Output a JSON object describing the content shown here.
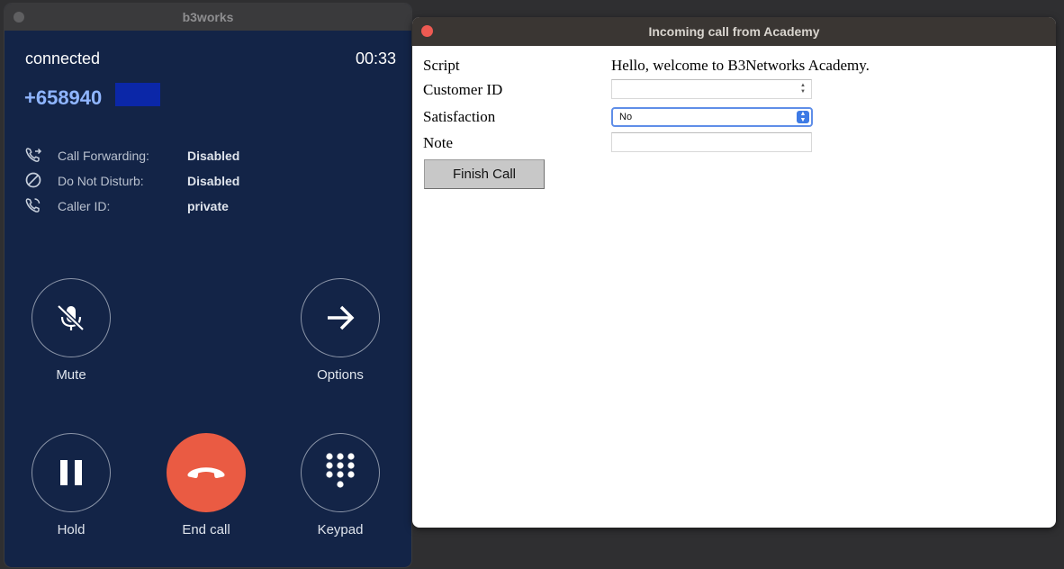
{
  "phone": {
    "title": "b3works",
    "status": "connected",
    "timer": "00:33",
    "number": "+658940",
    "info": [
      {
        "label": "Call Forwarding:",
        "value": "Disabled",
        "icon": "call-forward-icon"
      },
      {
        "label": "Do Not Disturb:",
        "value": "Disabled",
        "icon": "do-not-disturb-icon"
      },
      {
        "label": "Caller ID:",
        "value": "private",
        "icon": "caller-id-icon"
      }
    ],
    "buttons": {
      "mute": "Mute",
      "options": "Options",
      "hold": "Hold",
      "end": "End call",
      "keypad": "Keypad"
    },
    "colors": {
      "background": "#132447",
      "end_call": "#ea5b43",
      "number": "#8fb5ff"
    }
  },
  "dialog": {
    "title": "Incoming call from Academy",
    "script_label": "Script",
    "script_value": "Hello, welcome to B3Networks Academy.",
    "customer_id_label": "Customer ID",
    "customer_id_value": "",
    "satisfaction_label": "Satisfaction",
    "satisfaction_value": "No",
    "note_label": "Note",
    "note_value": "",
    "finish_label": "Finish Call"
  }
}
